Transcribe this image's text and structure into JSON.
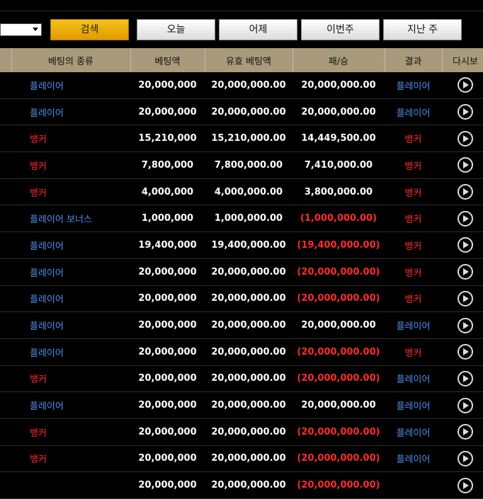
{
  "toolbar": {
    "search_label": "검색",
    "today_label": "오늘",
    "yesterday_label": "어제",
    "this_week_label": "이번주",
    "last_week_label": "지난 주"
  },
  "table": {
    "headers": [
      "베팅의 종류",
      "베팅액",
      "유효 베팅액",
      "패/승",
      "결과",
      "다시보"
    ],
    "rows": [
      {
        "type": "플레이어",
        "type_color": "blue",
        "bet": "20,000,000",
        "valid": "20,000,000.00",
        "win": "20,000,000.00",
        "win_neg": false,
        "result": "플레이어",
        "result_color": "blue"
      },
      {
        "type": "플레이어",
        "type_color": "blue",
        "bet": "20,000,000",
        "valid": "20,000,000.00",
        "win": "20,000,000.00",
        "win_neg": false,
        "result": "플레이어",
        "result_color": "blue"
      },
      {
        "type": "뱅커",
        "type_color": "red",
        "bet": "15,210,000",
        "valid": "15,210,000.00",
        "win": "14,449,500.00",
        "win_neg": false,
        "result": "뱅커",
        "result_color": "red"
      },
      {
        "type": "뱅커",
        "type_color": "red",
        "bet": "7,800,000",
        "valid": "7,800,000.00",
        "win": "7,410,000.00",
        "win_neg": false,
        "result": "뱅커",
        "result_color": "red"
      },
      {
        "type": "뱅커",
        "type_color": "red",
        "bet": "4,000,000",
        "valid": "4,000,000.00",
        "win": "3,800,000.00",
        "win_neg": false,
        "result": "뱅커",
        "result_color": "red"
      },
      {
        "type": "플레이어 보너스",
        "type_color": "blue",
        "bet": "1,000,000",
        "valid": "1,000,000.00",
        "win": "(1,000,000.00)",
        "win_neg": true,
        "result": "뱅커",
        "result_color": "red"
      },
      {
        "type": "플레이어",
        "type_color": "blue",
        "bet": "19,400,000",
        "valid": "19,400,000.00",
        "win": "(19,400,000.00)",
        "win_neg": true,
        "result": "뱅커",
        "result_color": "red"
      },
      {
        "type": "플레이어",
        "type_color": "blue",
        "bet": "20,000,000",
        "valid": "20,000,000.00",
        "win": "(20,000,000.00)",
        "win_neg": true,
        "result": "뱅커",
        "result_color": "red"
      },
      {
        "type": "플레이어",
        "type_color": "blue",
        "bet": "20,000,000",
        "valid": "20,000,000.00",
        "win": "(20,000,000.00)",
        "win_neg": true,
        "result": "뱅커",
        "result_color": "red"
      },
      {
        "type": "플레이어",
        "type_color": "blue",
        "bet": "20,000,000",
        "valid": "20,000,000.00",
        "win": "20,000,000.00",
        "win_neg": false,
        "result": "플레이어",
        "result_color": "blue"
      },
      {
        "type": "플레이어",
        "type_color": "blue",
        "bet": "20,000,000",
        "valid": "20,000,000.00",
        "win": "(20,000,000.00)",
        "win_neg": true,
        "result": "뱅커",
        "result_color": "red"
      },
      {
        "type": "뱅커",
        "type_color": "red",
        "bet": "20,000,000",
        "valid": "20,000,000.00",
        "win": "(20,000,000.00)",
        "win_neg": true,
        "result": "플레이어",
        "result_color": "blue"
      },
      {
        "type": "플레이어",
        "type_color": "blue",
        "bet": "20,000,000",
        "valid": "20,000,000.00",
        "win": "20,000,000.00",
        "win_neg": false,
        "result": "플레이어",
        "result_color": "blue"
      },
      {
        "type": "뱅커",
        "type_color": "red",
        "bet": "20,000,000",
        "valid": "20,000,000.00",
        "win": "(20,000,000.00)",
        "win_neg": true,
        "result": "플레이어",
        "result_color": "blue"
      },
      {
        "type": "뱅커",
        "type_color": "red",
        "bet": "20,000,000",
        "valid": "20,000,000.00",
        "win": "(20,000,000.00)",
        "win_neg": true,
        "result": "플레이어",
        "result_color": "blue"
      },
      {
        "type": "",
        "type_color": "blue",
        "bet": "20,000,000",
        "valid": "20,000,000.00",
        "win": "(20,000,000.00)",
        "win_neg": true,
        "result": "",
        "result_color": "blue"
      }
    ]
  },
  "icons": {
    "replay": "play-circle-icon",
    "dropdown": "chevron-down-icon"
  },
  "colors": {
    "header_bg": "#a89a7a",
    "search_btn": "#f0b000",
    "blue": "#4d8ef0",
    "red": "#ff2b2b"
  }
}
